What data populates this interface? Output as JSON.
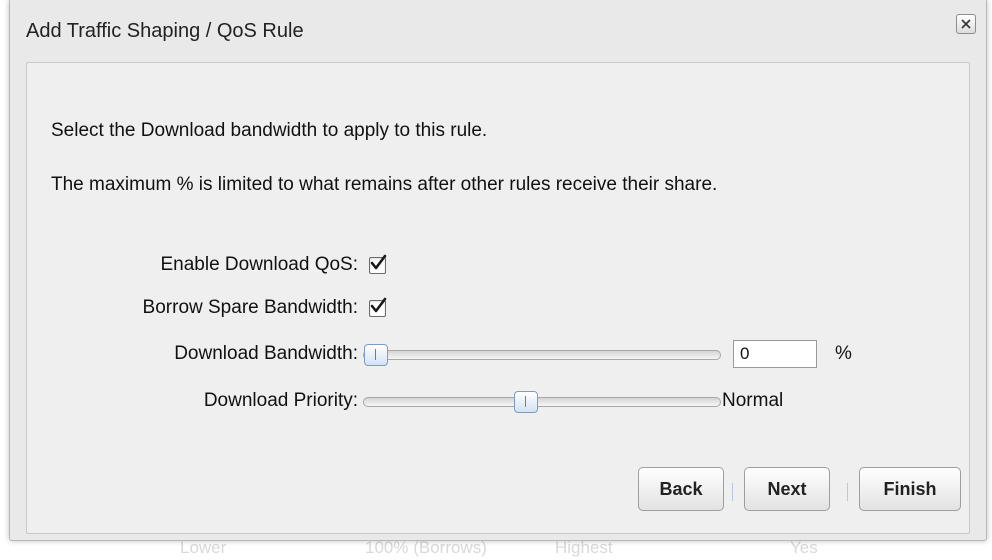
{
  "background": {
    "row_text": [
      "Lower",
      "100% (Borrows)",
      "Highest",
      "Yes"
    ]
  },
  "dialog": {
    "title": "Add Traffic Shaping / QoS Rule",
    "close_icon": "close-x-icon",
    "paragraphs": [
      "Select the Download bandwidth to apply to this rule.",
      "The maximum % is limited to what remains after other rules receive their share."
    ],
    "fields": {
      "enable_qos": {
        "label": "Enable Download QoS:",
        "checked": true
      },
      "borrow_bandwidth": {
        "label": "Borrow Spare Bandwidth:",
        "checked": true
      },
      "download_bandwidth": {
        "label": "Download Bandwidth:",
        "value": "0",
        "unit": "%",
        "slider_fraction": 0
      },
      "download_priority": {
        "label": "Download Priority:",
        "value_text": "Normal",
        "slider_fraction": 0.45
      }
    },
    "buttons": {
      "back": "Back",
      "next": "Next",
      "finish": "Finish"
    }
  },
  "colors": {
    "slider_handle": "#d4e2f3",
    "checkbox_check": "#1a1a1a"
  }
}
